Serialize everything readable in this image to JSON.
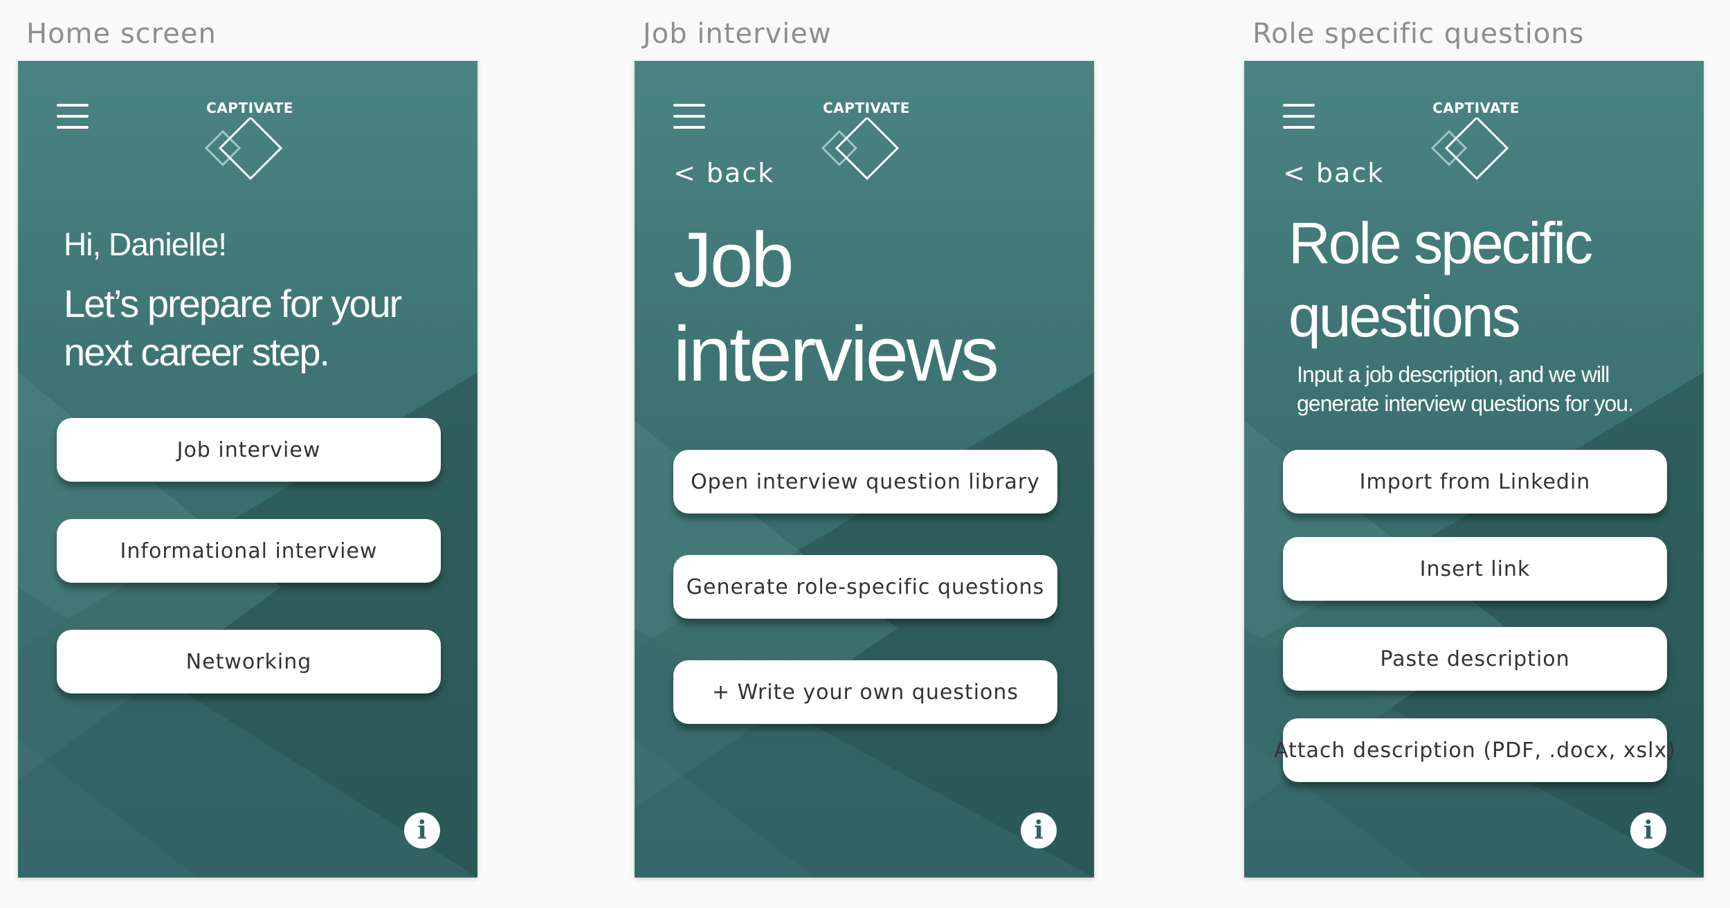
{
  "screens": [
    {
      "label": "Home screen",
      "logo_text": "CAPTIVATE",
      "greeting": "Hi, Danielle!",
      "subtitle_lines": [
        "Let’s prepare for your",
        "next career step."
      ],
      "buttons": [
        "Job interview",
        "Informational interview",
        "Networking"
      ]
    },
    {
      "label": "Job interview",
      "logo_text": "CAPTIVATE",
      "back": "< back",
      "title_lines": [
        "Job",
        "interviews"
      ],
      "buttons": [
        "Open interview question library",
        "Generate role-specific questions",
        "+ Write your own questions"
      ]
    },
    {
      "label": "Role specific questions",
      "logo_text": "CAPTIVATE",
      "back": "< back",
      "title_lines": [
        "Role specific",
        "questions"
      ],
      "description_lines": [
        "Input a job description, and we will",
        "generate interview questions for you."
      ],
      "buttons": [
        "Import from Linkedin",
        "Insert link",
        "Paste description",
        "Attach description (PDF, .docx, xslx)"
      ]
    }
  ],
  "colors": {
    "teal_light": "#4a8482",
    "teal_dark": "#2f6261",
    "button_bg": "#ffffff",
    "button_text": "#333333"
  },
  "icons": {
    "menu": "hamburger-icon",
    "logo": "diamond-logo-icon",
    "info": "info-icon"
  }
}
